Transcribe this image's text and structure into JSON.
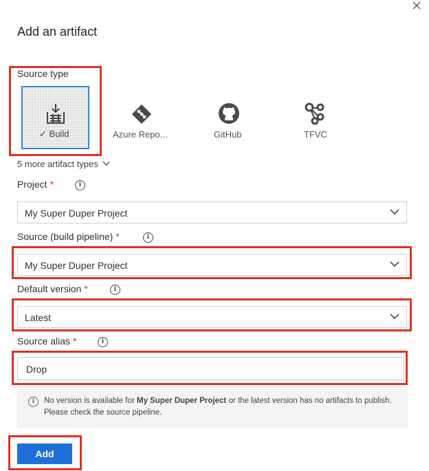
{
  "dialog": {
    "title": "Add an artifact"
  },
  "source_type": {
    "label": "Source type",
    "tiles": [
      {
        "label": "Build",
        "selected": true,
        "icon": "build-pipeline-icon"
      },
      {
        "label": "Azure Repo...",
        "selected": false,
        "icon": "azure-repos-icon"
      },
      {
        "label": "GitHub",
        "selected": false,
        "icon": "github-icon"
      },
      {
        "label": "TFVC",
        "selected": false,
        "icon": "tfvc-icon"
      }
    ],
    "more_types": "5 more artifact types"
  },
  "project": {
    "label": "Project",
    "required": "*",
    "value": "My Super Duper Project"
  },
  "source": {
    "label": "Source (build pipeline)",
    "required": "*",
    "value": "My Super Duper Project"
  },
  "default_version": {
    "label": "Default version",
    "required": "*",
    "value": "Latest"
  },
  "source_alias": {
    "label": "Source alias",
    "required": "*",
    "value": "Drop"
  },
  "notice": {
    "prefix": "No version is available for ",
    "project": "My Super Duper Project",
    "suffix": " or the latest version has no artifacts to publish. Please check the source pipeline."
  },
  "add_button": {
    "label": "Add"
  },
  "colors": {
    "accent": "#1e6fd9",
    "highlight": "#e0321f",
    "required": "#d13438",
    "selected_border": "#2b88d8"
  }
}
